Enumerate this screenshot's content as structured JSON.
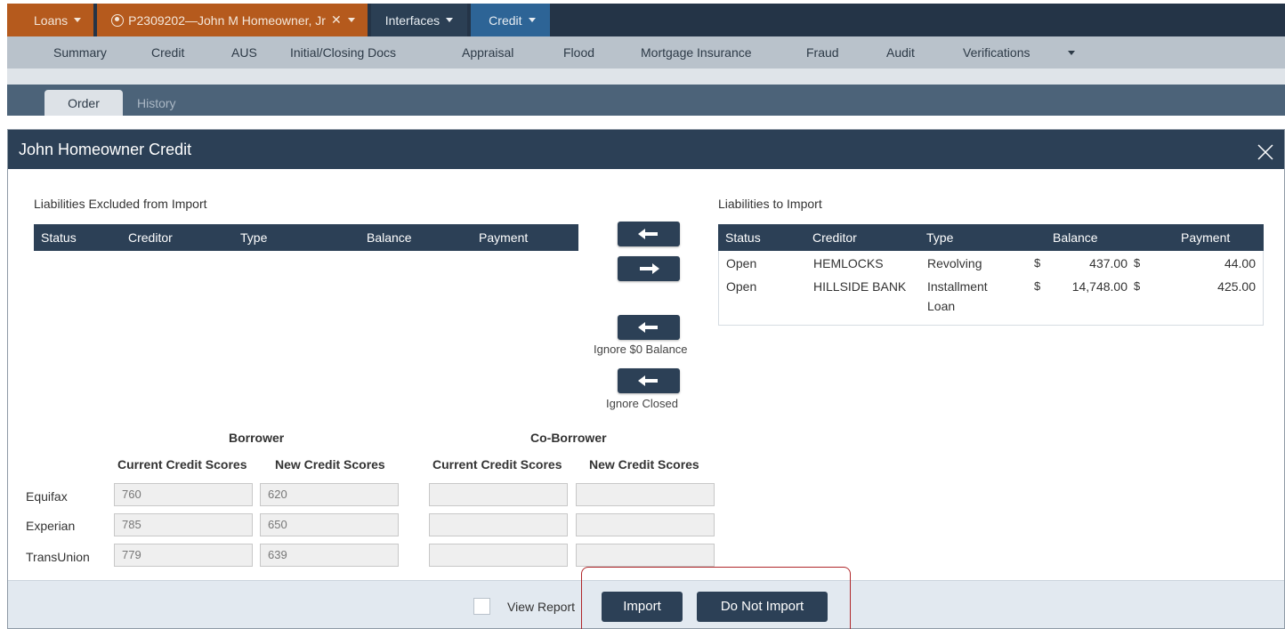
{
  "topnav": {
    "loans_label": "Loans",
    "loan_label": "P2309202—John M Homeowner, Jr",
    "interfaces_label": "Interfaces",
    "credit_label": "Credit"
  },
  "subnav": {
    "items": [
      "Summary",
      "Credit",
      "AUS",
      "Initial/Closing Docs",
      "Appraisal",
      "Flood",
      "Mortgage Insurance",
      "Fraud",
      "Audit",
      "Verifications"
    ]
  },
  "tabs": {
    "order": "Order",
    "history": "History"
  },
  "modal": {
    "title": "John Homeowner Credit",
    "excluded": {
      "title": "Liabilities Excluded from Import",
      "columns": [
        "Status",
        "Creditor",
        "Type",
        "Balance",
        "Payment"
      ]
    },
    "to_import": {
      "title": "Liabilities to Import",
      "columns": [
        "Status",
        "Creditor",
        "Type",
        "Balance",
        "Payment"
      ],
      "rows": [
        {
          "status": "Open",
          "creditor": "HEMLOCKS",
          "type": "Revolving",
          "type2": "",
          "cur1": "$",
          "balance": "437.00",
          "cur2": "$",
          "payment": "44.00"
        },
        {
          "status": "Open",
          "creditor": "HILLSIDE BANK",
          "type": "Installment",
          "type2": "Loan",
          "cur1": "$",
          "balance": "14,748.00",
          "cur2": "$",
          "payment": "425.00"
        }
      ]
    },
    "ignore_zero_label": "Ignore $0 Balance",
    "ignore_closed_label": "Ignore Closed",
    "scores": {
      "borrower_label": "Borrower",
      "coborrower_label": "Co-Borrower",
      "current_label": "Current Credit Scores",
      "new_label": "New Credit Scores",
      "rows": [
        {
          "bureau": "Equifax",
          "b_current": "760",
          "b_new": "620",
          "c_current": "",
          "c_new": ""
        },
        {
          "bureau": "Experian",
          "b_current": "785",
          "b_new": "650",
          "c_current": "",
          "c_new": ""
        },
        {
          "bureau": "TransUnion",
          "b_current": "779",
          "b_new": "639",
          "c_current": "",
          "c_new": ""
        }
      ]
    },
    "footer": {
      "view_report_label": "View Report",
      "import_label": "Import",
      "do_not_import_label": "Do Not Import"
    }
  },
  "colors": {
    "nav_dark": "#243447",
    "loans_orange": "#b55a1d",
    "credit_blue": "#2d6496",
    "header_navy": "#2c4056",
    "highlight_red": "#b0272a"
  }
}
